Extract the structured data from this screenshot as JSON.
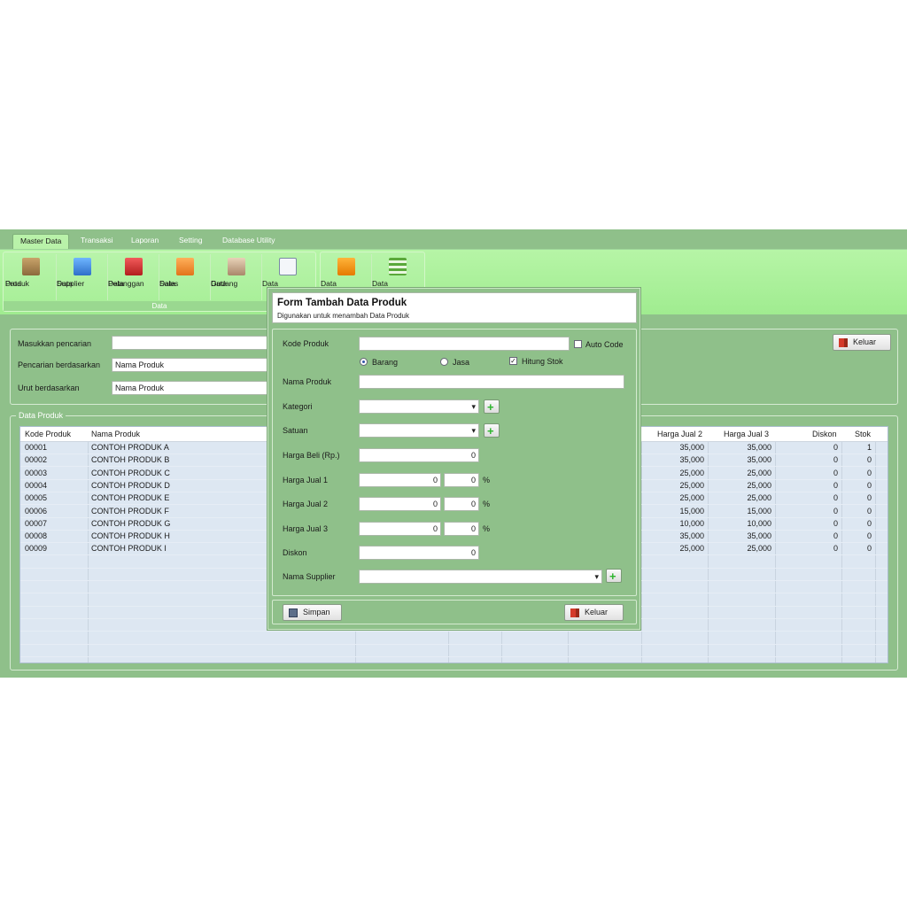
{
  "menu": {
    "tabs": [
      "Master Data",
      "Transaksi",
      "Laporan",
      "Setting",
      "Database Utility"
    ]
  },
  "ribbon": {
    "group1_label": "Data",
    "buttons": [
      {
        "line1": "Data",
        "line2": "Produk",
        "icon": "box-icon"
      },
      {
        "line1": "Data",
        "line2": "Supplier",
        "icon": "supplier-icon"
      },
      {
        "line1": "Data",
        "line2": "Pelanggan",
        "icon": "customer-card-icon"
      },
      {
        "line1": "Data",
        "line2": "Sales",
        "icon": "sales-person-icon"
      },
      {
        "line1": "Data",
        "line2": "Gudang",
        "icon": "warehouse-icon"
      },
      {
        "line1": "Data",
        "line2": "",
        "icon": "document-icon"
      },
      {
        "line1": "Data",
        "line2": "",
        "icon": "folder-icon"
      },
      {
        "line1": "Data",
        "line2": "",
        "icon": "list-icon"
      }
    ]
  },
  "filter": {
    "search_label": "Masukkan pencarian",
    "search_value": "",
    "by_label": "Pencarian berdasarkan",
    "by_value": "Nama Produk",
    "sort_label": "Urut berdasarkan",
    "sort_value": "Nama Produk",
    "exit_label": "Keluar"
  },
  "table": {
    "legend": "Data Produk",
    "headers": {
      "kode": "Kode Produk",
      "nama": "Nama Produk",
      "hj2": "Harga Jual 2",
      "hj3": "Harga Jual 3",
      "diskon": "Diskon",
      "stok": "Stok"
    },
    "rows": [
      {
        "kode": "00001",
        "nama": "CONTOH PRODUK A",
        "hj2": "35,000",
        "hj3": "35,000",
        "diskon": "0",
        "stok": "1"
      },
      {
        "kode": "00002",
        "nama": "CONTOH PRODUK B",
        "hj2": "35,000",
        "hj3": "35,000",
        "diskon": "0",
        "stok": "0"
      },
      {
        "kode": "00003",
        "nama": "CONTOH PRODUK C",
        "hj2": "25,000",
        "hj3": "25,000",
        "diskon": "0",
        "stok": "0"
      },
      {
        "kode": "00004",
        "nama": "CONTOH PRODUK D",
        "hj2": "25,000",
        "hj3": "25,000",
        "diskon": "0",
        "stok": "0"
      },
      {
        "kode": "00005",
        "nama": "CONTOH PRODUK E",
        "hj2": "25,000",
        "hj3": "25,000",
        "diskon": "0",
        "stok": "0"
      },
      {
        "kode": "00006",
        "nama": "CONTOH PRODUK F",
        "hj2": "15,000",
        "hj3": "15,000",
        "diskon": "0",
        "stok": "0"
      },
      {
        "kode": "00007",
        "nama": "CONTOH PRODUK G",
        "hj2": "10,000",
        "hj3": "10,000",
        "diskon": "0",
        "stok": "0"
      },
      {
        "kode": "00008",
        "nama": "CONTOH PRODUK H",
        "hj2": "35,000",
        "hj3": "35,000",
        "diskon": "0",
        "stok": "0"
      },
      {
        "kode": "00009",
        "nama": "CONTOH PRODUK I",
        "hj2": "25,000",
        "hj3": "25,000",
        "diskon": "0",
        "stok": "0"
      }
    ]
  },
  "dialog": {
    "title": "Form Tambah Data Produk",
    "subtitle": "Digunakan untuk menambah Data Produk",
    "kode_label": "Kode Produk",
    "kode_value": "",
    "auto_code_label": "Auto Code",
    "auto_code_checked": false,
    "radio_barang": "Barang",
    "radio_jasa": "Jasa",
    "selected_type": "Barang",
    "hitung_stok_label": "Hitung Stok",
    "hitung_stok_checked": true,
    "nama_label": "Nama Produk",
    "nama_value": "",
    "kategori_label": "Kategori",
    "kategori_value": "",
    "satuan_label": "Satuan",
    "satuan_value": "",
    "harga_beli_label": "Harga Beli (Rp.)",
    "harga_beli_value": "0",
    "harga_jual1_label": "Harga Jual 1",
    "harga_jual1_value": "0",
    "harga_jual1_pct": "0",
    "harga_jual2_label": "Harga Jual 2",
    "harga_jual2_value": "0",
    "harga_jual2_pct": "0",
    "harga_jual3_label": "Harga Jual 3",
    "harga_jual3_value": "0",
    "harga_jual3_pct": "0",
    "pct_symbol": "%",
    "diskon_label": "Diskon",
    "diskon_value": "0",
    "supplier_label": "Nama Supplier",
    "supplier_value": "",
    "save_label": "Simpan",
    "exit_label": "Keluar"
  },
  "colors": {
    "app_bg": "#8fc08a",
    "ribbon": "#a6ee96",
    "grid_bg": "#dde7f2"
  }
}
